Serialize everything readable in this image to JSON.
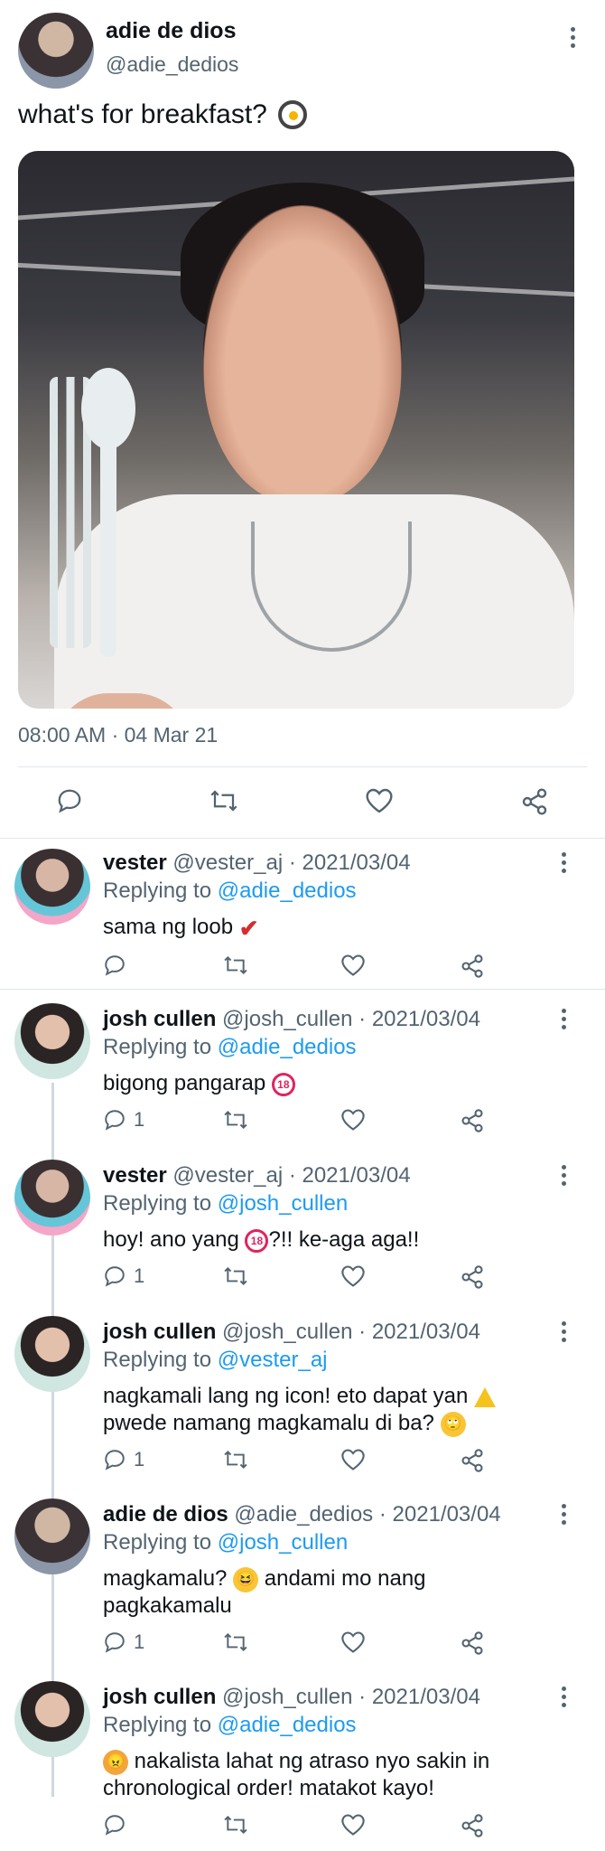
{
  "main": {
    "name": "adie de dios",
    "handle": "@adie_dedios",
    "text": "what's for breakfast?",
    "timestamp": "08:00 AM · 04 Mar 21"
  },
  "replies": [
    {
      "name": "vester",
      "handle": "@vester_aj",
      "date": "· 2021/03/04",
      "replying_prefix": "Replying to",
      "replying_to": "@adie_dedios",
      "text": "sama ng loob",
      "count": ""
    },
    {
      "name": "josh cullen",
      "handle": "@josh_cullen",
      "date": "· 2021/03/04",
      "replying_prefix": "Replying to",
      "replying_to": "@adie_dedios",
      "text": "bigong pangarap",
      "count": "1"
    },
    {
      "name": "vester",
      "handle": "@vester_aj",
      "date": "· 2021/03/04",
      "replying_prefix": "Replying to",
      "replying_to": "@josh_cullen",
      "text_a": "hoy! ano yang",
      "text_b": "?!! ke-aga aga!!",
      "count": "1"
    },
    {
      "name": "josh cullen",
      "handle": "@josh_cullen",
      "date": "· 2021/03/04",
      "replying_prefix": "Replying to",
      "replying_to": "@vester_aj",
      "text_a": "nagkamali lang ng icon! eto dapat yan",
      "text_b": "pwede namang magkamalu di ba?",
      "count": "1"
    },
    {
      "name": "adie de dios",
      "handle": "@adie_dedios",
      "date": "· 2021/03/04",
      "replying_prefix": "Replying to",
      "replying_to": "@josh_cullen",
      "text_a": "magkamalu?",
      "text_b": "andami mo nang",
      "text_c": "pagkakamalu",
      "count": "1"
    },
    {
      "name": "josh cullen",
      "handle": "@josh_cullen",
      "date": "· 2021/03/04",
      "replying_prefix": "Replying to",
      "replying_to": "@adie_dedios",
      "text_a": "nakalista lahat ng atraso nyo sakin in",
      "text_b": "chronological order! matakot kayo!",
      "count": ""
    }
  ],
  "icons": {
    "reply": "reply-icon",
    "retweet": "retweet-icon",
    "like": "heart-icon",
    "share": "share-icon",
    "more": "more-icon",
    "adult": "18",
    "check": "✔"
  },
  "colors": {
    "accent": "#1d9bf0",
    "muted": "#536471",
    "separator": "#e1e6ea"
  }
}
